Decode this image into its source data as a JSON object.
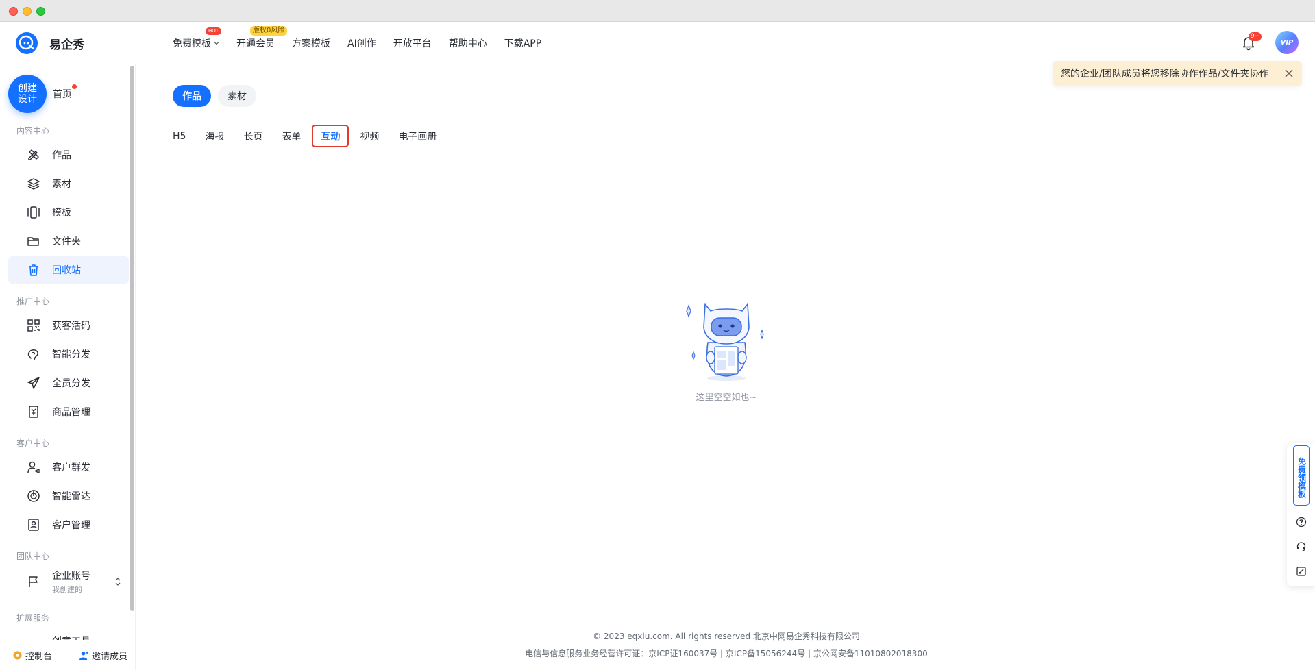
{
  "window": {},
  "header": {
    "brand": "易企秀",
    "nav": [
      {
        "label": "免费模板",
        "badge": "HOT"
      },
      {
        "label": "开通会员",
        "badge": "版权0风险"
      },
      {
        "label": "方案模板"
      },
      {
        "label": "AI创作"
      },
      {
        "label": "开放平台"
      },
      {
        "label": "帮助中心"
      },
      {
        "label": "下载APP"
      }
    ],
    "notification_count": "9+",
    "avatar_label": "VIP"
  },
  "sidebar": {
    "create_button": "创建设计",
    "home": "首页",
    "sections": [
      {
        "title": "内容中心",
        "items": [
          "作品",
          "素材",
          "模板",
          "文件夹",
          "回收站"
        ]
      },
      {
        "title": "推广中心",
        "items": [
          "获客活码",
          "智能分发",
          "全员分发",
          "商品管理"
        ]
      },
      {
        "title": "客户中心",
        "items": [
          "客户群发",
          "智能雷达",
          "客户管理"
        ]
      },
      {
        "title": "团队中心",
        "items": [
          "企业账号"
        ]
      },
      {
        "title": "扩展服务",
        "items": []
      }
    ],
    "org_sub": "我创建的",
    "clipped_item": "创意工具",
    "active_item": "回收站",
    "bottom": {
      "console": "控制台",
      "invite": "邀请成员"
    }
  },
  "content": {
    "segments": [
      "作品",
      "素材"
    ],
    "active_segment": "作品",
    "tabs": [
      "H5",
      "海报",
      "长页",
      "表单",
      "互动",
      "视频",
      "电子画册"
    ],
    "active_tab": "互动",
    "empty_text": "这里空空如也~"
  },
  "toast": {
    "message": "您的企业/团队成员将您移除协作作品/文件夹协作"
  },
  "footer": {
    "line1": "© 2023 eqxiu.com. All rights reserved 北京中网易企秀科技有限公司",
    "line2": "电信与信息服务业务经营许可证：京ICP证160037号 | 京ICP备15056244号 | 京公网安备11010802018300"
  },
  "float_bar": {
    "free_template": "免费领模板"
  },
  "colors": {
    "primary": "#1470ff",
    "danger": "#f44336",
    "toast_bg": "#fdefd4",
    "highlight_border": "#e23a2b"
  }
}
